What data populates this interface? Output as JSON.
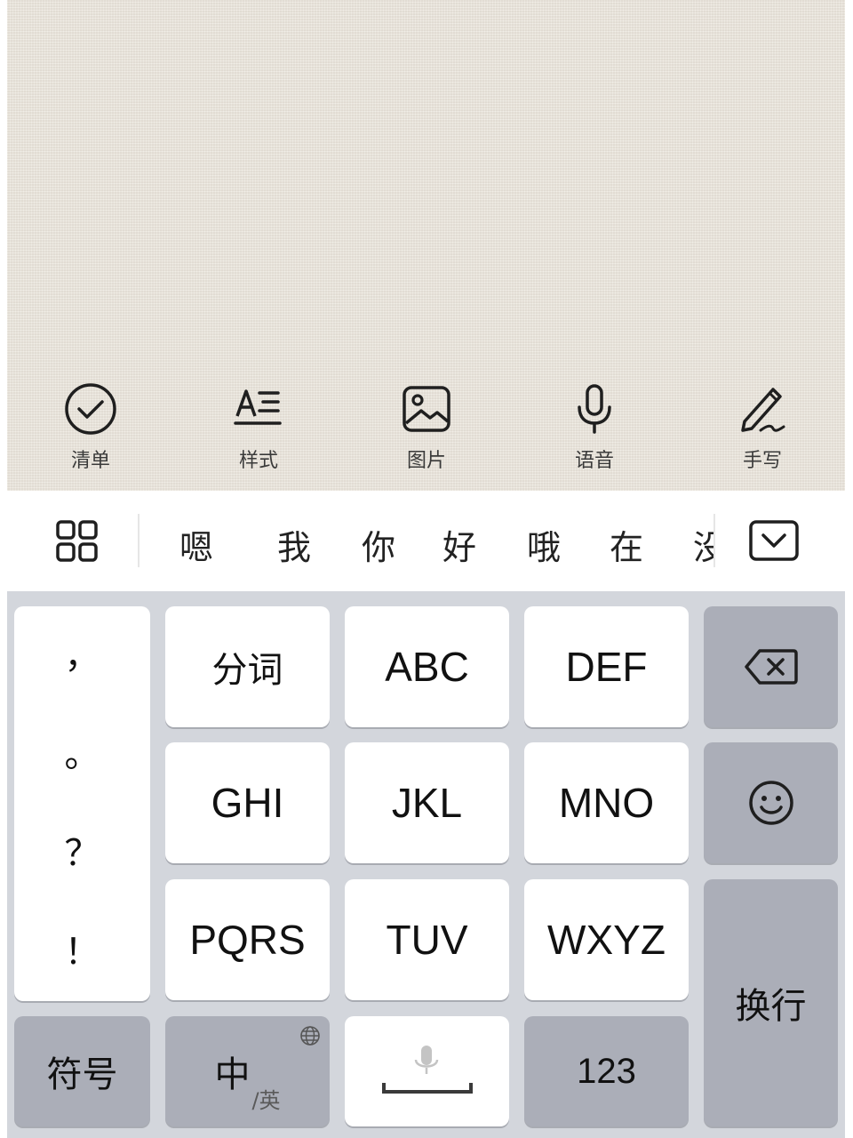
{
  "toolbar": {
    "items": [
      {
        "label": "清单",
        "icon": "checklist-icon"
      },
      {
        "label": "样式",
        "icon": "text-style-icon"
      },
      {
        "label": "图片",
        "icon": "image-icon"
      },
      {
        "label": "语音",
        "icon": "microphone-icon"
      },
      {
        "label": "手写",
        "icon": "handwriting-pen-icon"
      }
    ]
  },
  "candidates": {
    "menu_icon": "grid-menu-icon",
    "words": [
      "嗯",
      "我",
      "你",
      "好",
      "哦",
      "在",
      "没"
    ],
    "collapse_icon": "collapse-keyboard-icon"
  },
  "keyboard": {
    "punctuation": [
      "，",
      "。",
      "？",
      "！"
    ],
    "row1": [
      "分词",
      "ABC",
      "DEF"
    ],
    "row2": [
      "GHI",
      "JKL",
      "MNO"
    ],
    "row3": [
      "PQRS",
      "TUV",
      "WXYZ"
    ],
    "delete_icon": "backspace-icon",
    "emoji_icon": "emoji-smile-icon",
    "enter": "换行",
    "symbols": "符号",
    "lang_main": "中",
    "lang_sub": "/英",
    "globe_icon": "globe-icon",
    "space_icon": "space-mic-icon",
    "numbers": "123"
  },
  "colors": {
    "note_background": "#ebe6dc",
    "keyboard_background": "#d3d6dc",
    "function_key": "#abaeb8",
    "letter_key": "#ffffff"
  }
}
